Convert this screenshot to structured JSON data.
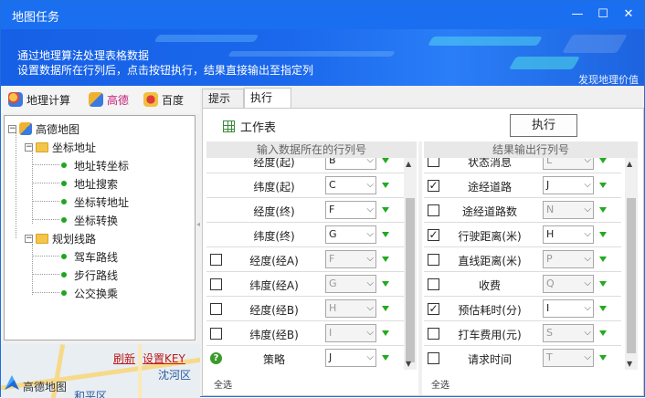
{
  "window": {
    "title": "地图任务",
    "minimize": "—",
    "maximize": "☐",
    "close": "✕"
  },
  "banner": {
    "line1": "通过地理算法处理表格数据",
    "line2": "设置数据所在行列后，点击按钮执行，结果直接输出至指定列",
    "right": "发现地理价值"
  },
  "source_bar": [
    {
      "label": "地理计算",
      "icon": "geo-compute-icon",
      "color": "#1a1a1a"
    },
    {
      "label": "高德",
      "icon": "amap-icon",
      "color": "#c0227a"
    },
    {
      "label": "百度",
      "icon": "baidu-icon",
      "color": "#1a1a1a"
    }
  ],
  "tree": {
    "root": "高德地图",
    "groups": [
      {
        "label": "坐标地址",
        "items": [
          "地址转坐标",
          "地址搜索",
          "坐标转地址",
          "坐标转换"
        ]
      },
      {
        "label": "规划线路",
        "items": [
          "驾车路线",
          "步行路线",
          "公交换乘"
        ]
      }
    ]
  },
  "map": {
    "link_refresh": "刷新",
    "link_key": "设置KEY",
    "district1": "沈河区",
    "brand": "高德地图",
    "district2": "和平区"
  },
  "tabs": [
    "提示",
    "执行"
  ],
  "active_tab": 1,
  "panel": {
    "worksheet": "工作表",
    "run_button": "执行",
    "left_header": "输入数据所在的行列号",
    "right_header": "结果输出行列号",
    "select_all": "全选"
  },
  "left_rows": [
    {
      "check": "none",
      "label": "经度(起)",
      "value": "B",
      "enabled": true
    },
    {
      "check": "none",
      "label": "纬度(起)",
      "value": "C",
      "enabled": true
    },
    {
      "check": "none",
      "label": "经度(终)",
      "value": "F",
      "enabled": true
    },
    {
      "check": "none",
      "label": "纬度(终)",
      "value": "G",
      "enabled": true
    },
    {
      "check": "off",
      "label": "经度(经A)",
      "value": "F",
      "enabled": false
    },
    {
      "check": "off",
      "label": "纬度(经A)",
      "value": "G",
      "enabled": false
    },
    {
      "check": "off",
      "label": "经度(经B)",
      "value": "H",
      "enabled": false
    },
    {
      "check": "off",
      "label": "纬度(经B)",
      "value": "I",
      "enabled": false
    },
    {
      "check": "help",
      "label": "策略",
      "value": "J",
      "enabled": true
    }
  ],
  "right_rows": [
    {
      "check": "off",
      "label": "状态消息",
      "value": "L",
      "enabled": false
    },
    {
      "check": "on",
      "label": "途经道路",
      "value": "J",
      "enabled": true
    },
    {
      "check": "off",
      "label": "途经道路数",
      "value": "N",
      "enabled": false
    },
    {
      "check": "on",
      "label": "行驶距离(米)",
      "value": "H",
      "enabled": true
    },
    {
      "check": "off",
      "label": "直线距离(米)",
      "value": "P",
      "enabled": false
    },
    {
      "check": "off",
      "label": "收费",
      "value": "Q",
      "enabled": false
    },
    {
      "check": "on",
      "label": "预估耗时(分)",
      "value": "I",
      "enabled": true
    },
    {
      "check": "off",
      "label": "打车费用(元)",
      "value": "S",
      "enabled": false
    },
    {
      "check": "off",
      "label": "请求时间",
      "value": "T",
      "enabled": false
    }
  ],
  "colors": {
    "title": "#1a6ff0",
    "accent_green": "#22aa22",
    "link_red": "#c01818"
  }
}
